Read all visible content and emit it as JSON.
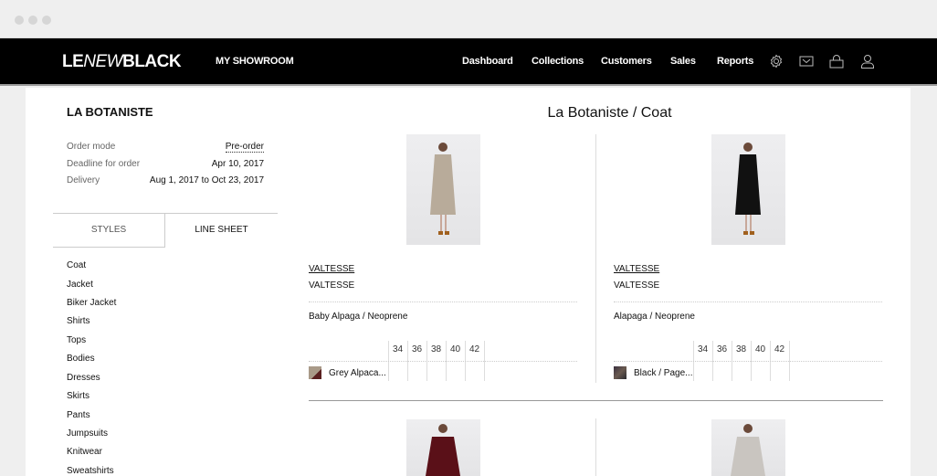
{
  "nav": {
    "logo": {
      "le": "LE",
      "new": "NEW",
      "black": "BLACK"
    },
    "section": "MY SHOWROOM",
    "menu": [
      "Dashboard",
      "Collections",
      "Customers",
      "Sales",
      "Reports"
    ],
    "icons": [
      "gear-icon",
      "mail-icon",
      "bag-icon",
      "user-icon"
    ]
  },
  "sidebar": {
    "brand": "LA BOTANISTE",
    "info": [
      {
        "label": "Order mode",
        "value": "Pre-order"
      },
      {
        "label": "Deadline for order",
        "value": "Apr 10, 2017"
      },
      {
        "label": "Delivery",
        "value": "Aug 1, 2017 to Oct 23, 2017"
      }
    ],
    "tabs": [
      "STYLES",
      "LINE SHEET"
    ],
    "active_tab": "LINE SHEET",
    "categories": [
      "Coat",
      "Jacket",
      "Biker Jacket",
      "Shirts",
      "Tops",
      "Bodies",
      "Dresses",
      "Skirts",
      "Pants",
      "Jumpsuits",
      "Knitwear",
      "Sweatshirts"
    ]
  },
  "main": {
    "title": "La Botaniste / Coat",
    "products": [
      {
        "brand_link": "VALTESSE",
        "name": "VALTESSE",
        "material": "Baby Alpaga / Neoprene",
        "sizes": [
          "34",
          "36",
          "38",
          "40",
          "42"
        ],
        "color": "Grey Alpaca...",
        "coat_color": "#b8ab9a"
      },
      {
        "brand_link": "VALTESSE",
        "name": "VALTESSE",
        "material": "Alapaga / Neoprene",
        "sizes": [
          "34",
          "36",
          "38",
          "40",
          "42"
        ],
        "color": "Black / Page...",
        "coat_color": "#111111"
      },
      {
        "coat_color": "#5a1018"
      },
      {
        "coat_color": "#c9c5c0"
      }
    ]
  }
}
